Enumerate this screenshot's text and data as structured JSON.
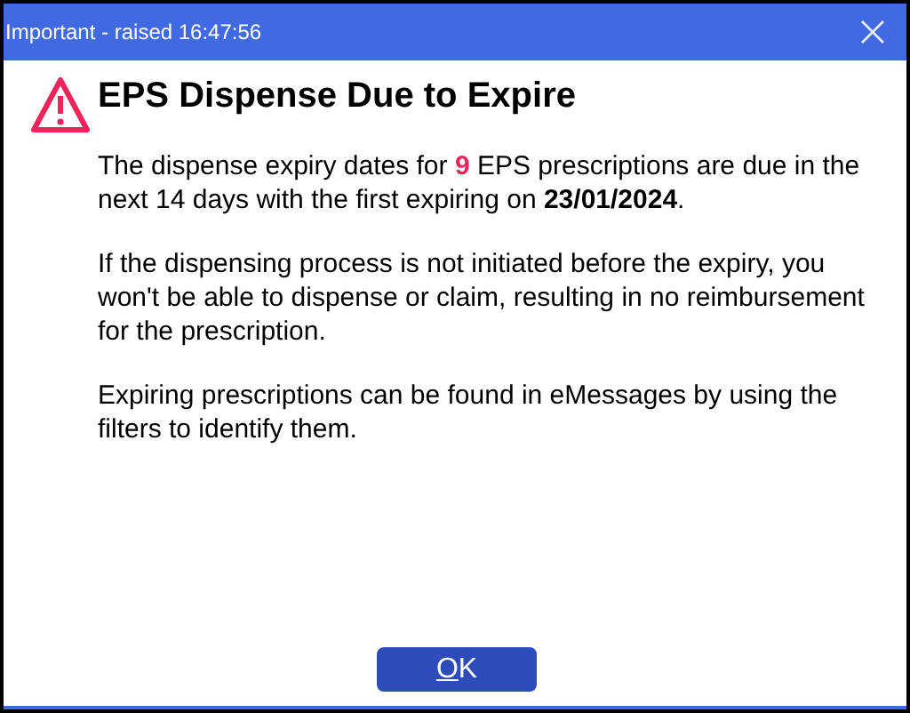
{
  "window": {
    "title": "Important - raised 16:47:56"
  },
  "heading": "EPS Dispense Due to Expire",
  "paragraphs": [
    [
      {
        "kind": "plain",
        "text": "The dispense expiry dates for "
      },
      {
        "kind": "count",
        "text": "9"
      },
      {
        "kind": "plain",
        "text": " EPS prescriptions are due in the next 14 days with the first expiring on "
      },
      {
        "kind": "date",
        "text": "23/01/2024"
      },
      {
        "kind": "plain",
        "text": "."
      }
    ],
    [
      {
        "kind": "plain",
        "text": "If the dispensing process is not initiated before the expiry, you won't be able to dispense or claim, resulting in no reimbursement for the prescription."
      }
    ],
    [
      {
        "kind": "plain",
        "text": "Expiring prescriptions can be found in eMessages by using the filters to identify them."
      }
    ]
  ],
  "button": {
    "label": "OK",
    "underline_first": true
  }
}
